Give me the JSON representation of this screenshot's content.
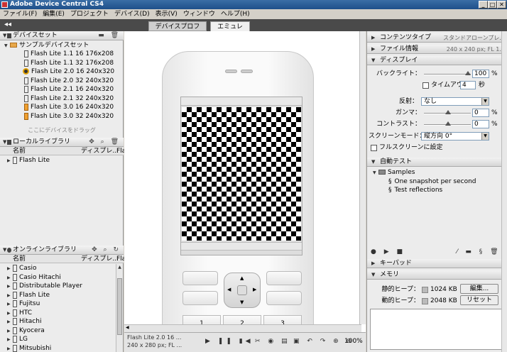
{
  "window": {
    "title": "Adobe Device Central CS4",
    "buttons": [
      "_",
      "□",
      "✕"
    ]
  },
  "menu": [
    "ファイル(F)",
    "編集(E)",
    "プロジェクト",
    "デバイス(D)",
    "表示(V)",
    "ウィンドウ",
    "ヘルプ(H)"
  ],
  "tabs": [
    {
      "label": "デバイスプロファイル",
      "active": false
    },
    {
      "label": "エミュレータ",
      "active": true
    }
  ],
  "collapse_glyph": "◂◂",
  "device_sets": {
    "title": "デバイスセット",
    "root": "サンプルデバイスセット",
    "items": [
      "Flash Lite 1.1 16 176x208",
      "Flash Lite 1.1 32 176x208",
      "Flash Lite 2.0 16 240x320",
      "Flash Lite 2.0 32 240x320",
      "Flash Lite 2.1 16 240x320",
      "Flash Lite 2.1 32 240x320",
      "Flash Lite 3.0 16 240x320",
      "Flash Lite 3.0 32 240x320"
    ],
    "hint": "ここにデバイスをドラッグ"
  },
  "local_library": {
    "title": "ローカルライブラリ",
    "col_name": "名前",
    "col_display": "ディスプレ...",
    "col_fl": "Fla",
    "items": [
      "Flash Lite"
    ]
  },
  "online_library": {
    "title": "オンラインライブラリ",
    "col_name": "名前",
    "col_display": "ディスプレ...",
    "col_fl": "Fla",
    "items": [
      "Casio",
      "Casio Hitachi",
      "Distributable Player",
      "Flash Lite",
      "Fujitsu",
      "HTC",
      "Hitachi",
      "Kyocera",
      "LG",
      "Mitsubishi"
    ]
  },
  "phone": {
    "keys": [
      "1",
      "2",
      "3"
    ]
  },
  "status": {
    "line1": "Flash Lite 2.0 16 ...",
    "line2": "240 x 280 px; FL ...",
    "zoom": "100%"
  },
  "right": {
    "content_type": {
      "title": "コンテンツタイプ",
      "value": "スタンドアローンプレ..."
    },
    "file_info": {
      "title": "ファイル情報",
      "value": "240 x 240 px; FL 1..."
    },
    "display": {
      "title": "ディスプレイ",
      "backlight_label": "バックライト：",
      "backlight_value": "100",
      "backlight_pct": 1.0,
      "timeout_label": "タイムアウト",
      "timeout_value": "4",
      "timeout_unit": "秒",
      "reflection_label": "反射：",
      "reflection_value": "なし",
      "gamma_label": "ガンマ：",
      "gamma_value": "0",
      "contrast_label": "コントラスト：",
      "contrast_value": "0",
      "screen_mode_label": "スクリーンモード：",
      "screen_mode_value": "縦方向 0°",
      "fullscreen_label": "フルスクリーンに設定",
      "pct": "%"
    },
    "auto_test": {
      "title": "自動テスト",
      "folder": "Samples",
      "items": [
        "One snapshot per second",
        "Test reflections"
      ]
    },
    "keypad": {
      "title": "キーパッド"
    },
    "memory": {
      "title": "メモリ",
      "static_label": "静的ヒープ：",
      "static_value": "1024 KB",
      "dynamic_label": "動的ヒープ：",
      "dynamic_value": "2048 KB",
      "edit_btn": "編集...",
      "reset_btn": "リセット"
    }
  },
  "colors": {
    "titlebar": "#1e4f8a",
    "tabstrip": "#4a4a4a",
    "panel": "#ececec"
  }
}
